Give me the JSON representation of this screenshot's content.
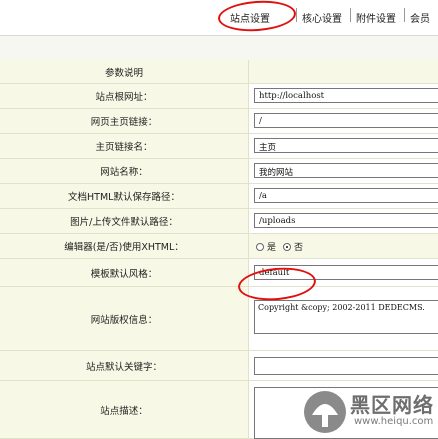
{
  "tabs": [
    "站点设置",
    "核心设置",
    "附件设置",
    "会员"
  ],
  "header": {
    "label": "参数说明"
  },
  "settings": [
    {
      "label": "站点根网址：",
      "value": "http://localhost"
    },
    {
      "label": "网页主页链接：",
      "value": "/"
    },
    {
      "label": "主页链接名：",
      "value": "主页"
    },
    {
      "label": "网站名称：",
      "value": "我的网站"
    },
    {
      "label": "文档HTML默认保存路径：",
      "value": "/a"
    },
    {
      "label": "图片/上传文件默认路径：",
      "value": "/uploads"
    },
    {
      "label": "编辑器(是/否)使用XHTML：",
      "options": [
        "是",
        "否"
      ],
      "selected": "否"
    },
    {
      "label": "模板默认风格：",
      "value": "default"
    },
    {
      "label": "网站版权信息：",
      "value": "Copyright &copy; 2002-2011 DEDECMS."
    },
    {
      "label": "站点默认关键字：",
      "value": ""
    },
    {
      "label": "站点描述：",
      "value": ""
    }
  ],
  "watermark": {
    "text": "黑区网络",
    "url": "www.heiqu.com"
  },
  "colors": {
    "label_bg": "#f8f8e6",
    "annotation": "#e01010"
  }
}
